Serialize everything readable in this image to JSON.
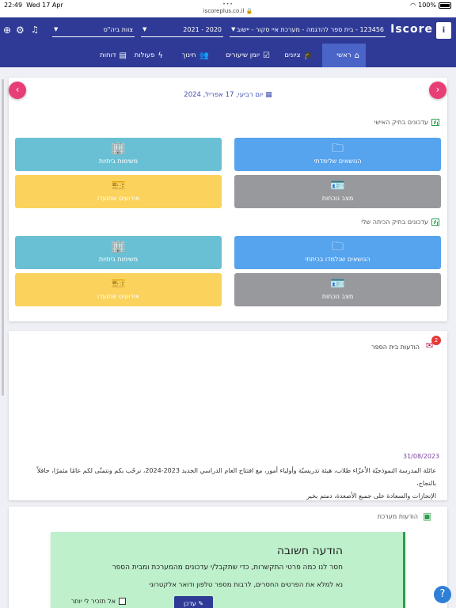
{
  "status": {
    "time": "22:49",
    "date": "Wed 17 Apr",
    "url": "iscoreplus.co.il",
    "battery": "100%"
  },
  "header": {
    "logo": "Iscore",
    "school": "123456 - בית ספר להדגמה - מערכת איי סקור - יישוב",
    "year": "2020 - 2021",
    "staff": "צוות ביה\"ס"
  },
  "nav": [
    {
      "label": "ראשי",
      "icon": "home-icon"
    },
    {
      "label": "ציונים",
      "icon": "graduation-cap-icon"
    },
    {
      "label": "יומן שיעורים",
      "icon": "calendar-check-icon"
    },
    {
      "label": "חינוך",
      "icon": "users-icon"
    },
    {
      "label": "פעולות",
      "icon": "bolt-icon"
    },
    {
      "label": "דוחות",
      "icon": "report-icon"
    }
  ],
  "updates": {
    "date": "יום רביעי, 17 אפריל, 2024",
    "personal_title": "עדכונים בתיק האישי",
    "class_title": "עדכונים בתיק הכיתה שלי",
    "personal_tiles": {
      "topics": "הנושאים שלימדתי",
      "homework": "משימות ביתיות",
      "attendance": "מצב נוכחות",
      "events": "אירועים שתועדו"
    },
    "class_tiles": {
      "topics": "הנושאים שנלמדו בכיתתי",
      "homework": "משימות ביתיות",
      "attendance": "מצב נוכחות",
      "events": "אירועים שתועדו"
    }
  },
  "school_messages": {
    "title": "הודעות בית הספר",
    "badge": "2",
    "date": "31/08/2023",
    "body_line1": "عائلة المدرسة النموذجيّة الأعزّاء طلاب، هيئة تدريسيّة وأولياء أمور، مع افتتاح العام الدراسي الجديد 2023-2024، نرحّب بكم ونتمنّى لكم عامًا مثمرًا، حافلاً بالنجاح،",
    "body_line2": "الإنجازات والسعادة على جميع الأصعدة، دمتم بخير"
  },
  "system_messages": {
    "title": "הודעות מערכת"
  },
  "notice": {
    "title": "הודעה חשובה",
    "line1": "חסר לנו כמה פרטי התקשרות, כדי שתקבל/י עדכונים מהמערכת ומבית הספר",
    "line2": "נא למלא את הפרטים החסרים, לרבות מספר טלפון ודואר אלקטרוני",
    "dont_remind": "אל תזכיר לי יותר",
    "update": "עדכן"
  },
  "colors": {
    "primary": "#2e3a95",
    "accent": "#e83e76",
    "blue_tile": "#56a3ee",
    "teal_tile": "#69c0d4",
    "gray_tile": "#98999c",
    "yellow_tile": "#fbd25c",
    "notice_bg": "#bdf0cb"
  }
}
